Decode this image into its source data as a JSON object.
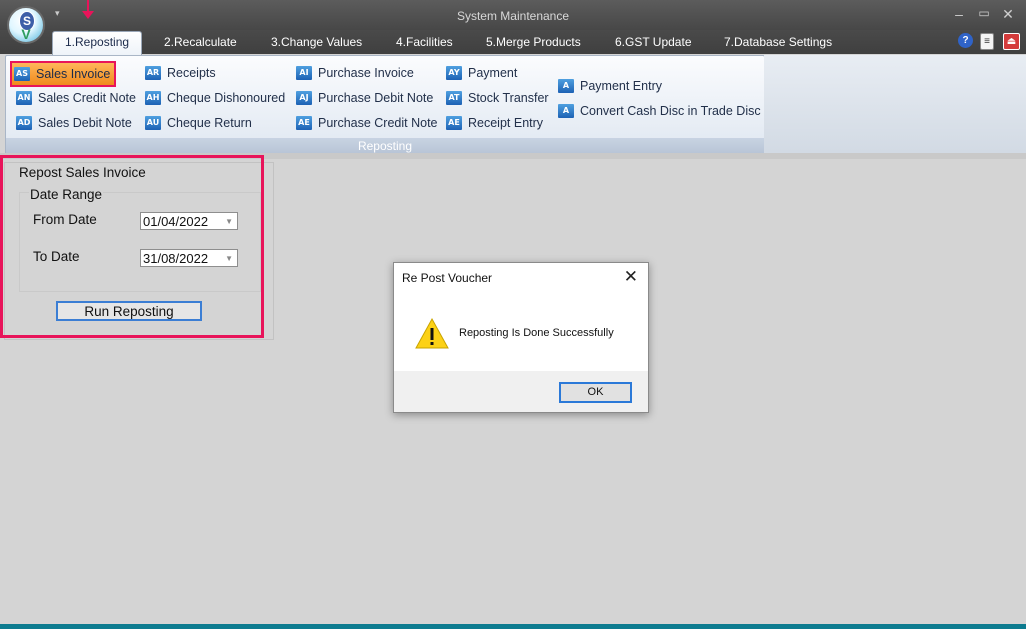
{
  "window": {
    "title": "System Maintenance",
    "minimize_glyph": "–",
    "maximize_glyph": "▭",
    "close_glyph": "✕"
  },
  "logo": {
    "letter": "S",
    "mark": "V"
  },
  "tabs": [
    {
      "label": "1.Reposting",
      "active": true
    },
    {
      "label": "2.Recalculate"
    },
    {
      "label": "3.Change Values"
    },
    {
      "label": "4.Facilities"
    },
    {
      "label": "5.Merge Products"
    },
    {
      "label": "6.GST Update"
    },
    {
      "label": "7.Database Settings"
    }
  ],
  "top_icons": [
    "help-icon",
    "document-icon",
    "exit-icon"
  ],
  "ribbon": {
    "group_label": "Reposting",
    "items": [
      {
        "label": "Sales Invoice",
        "icon": "AS",
        "highlighted": true
      },
      {
        "label": "Sales Credit Note",
        "icon": "AN"
      },
      {
        "label": "Sales Debit Note",
        "icon": "AD"
      },
      {
        "label": "Receipts",
        "icon": "AR"
      },
      {
        "label": "Cheque Dishonoured",
        "icon": "AH"
      },
      {
        "label": "Cheque Return",
        "icon": "AU"
      },
      {
        "label": "Purchase Invoice",
        "icon": "AI"
      },
      {
        "label": "Purchase Debit Note",
        "icon": "AJ"
      },
      {
        "label": "Purchase Credit Note",
        "icon": "AE"
      },
      {
        "label": "Payment",
        "icon": "AY"
      },
      {
        "label": "Stock Transfer",
        "icon": "AT"
      },
      {
        "label": "Receipt Entry",
        "icon": "AE"
      },
      {
        "label": "Payment Entry",
        "icon": "A"
      },
      {
        "label": "Convert Cash Disc in Trade Disc",
        "icon": "A"
      }
    ]
  },
  "panel": {
    "title": "Repost Sales Invoice",
    "group_title": "Date Range",
    "from_label": "From Date",
    "from_value": "01/04/2022",
    "to_label": "To Date",
    "to_value": "31/08/2022",
    "run_button": "Run Reposting"
  },
  "dialog": {
    "title": "Re Post Voucher",
    "close_glyph": "✕",
    "message": "Reposting Is Done Successfully",
    "ok_label": "OK",
    "icon": "warning-icon"
  },
  "colors": {
    "annotation": "#e8145a",
    "highlight": "#f39a2b",
    "accent": "#2b79d8"
  }
}
